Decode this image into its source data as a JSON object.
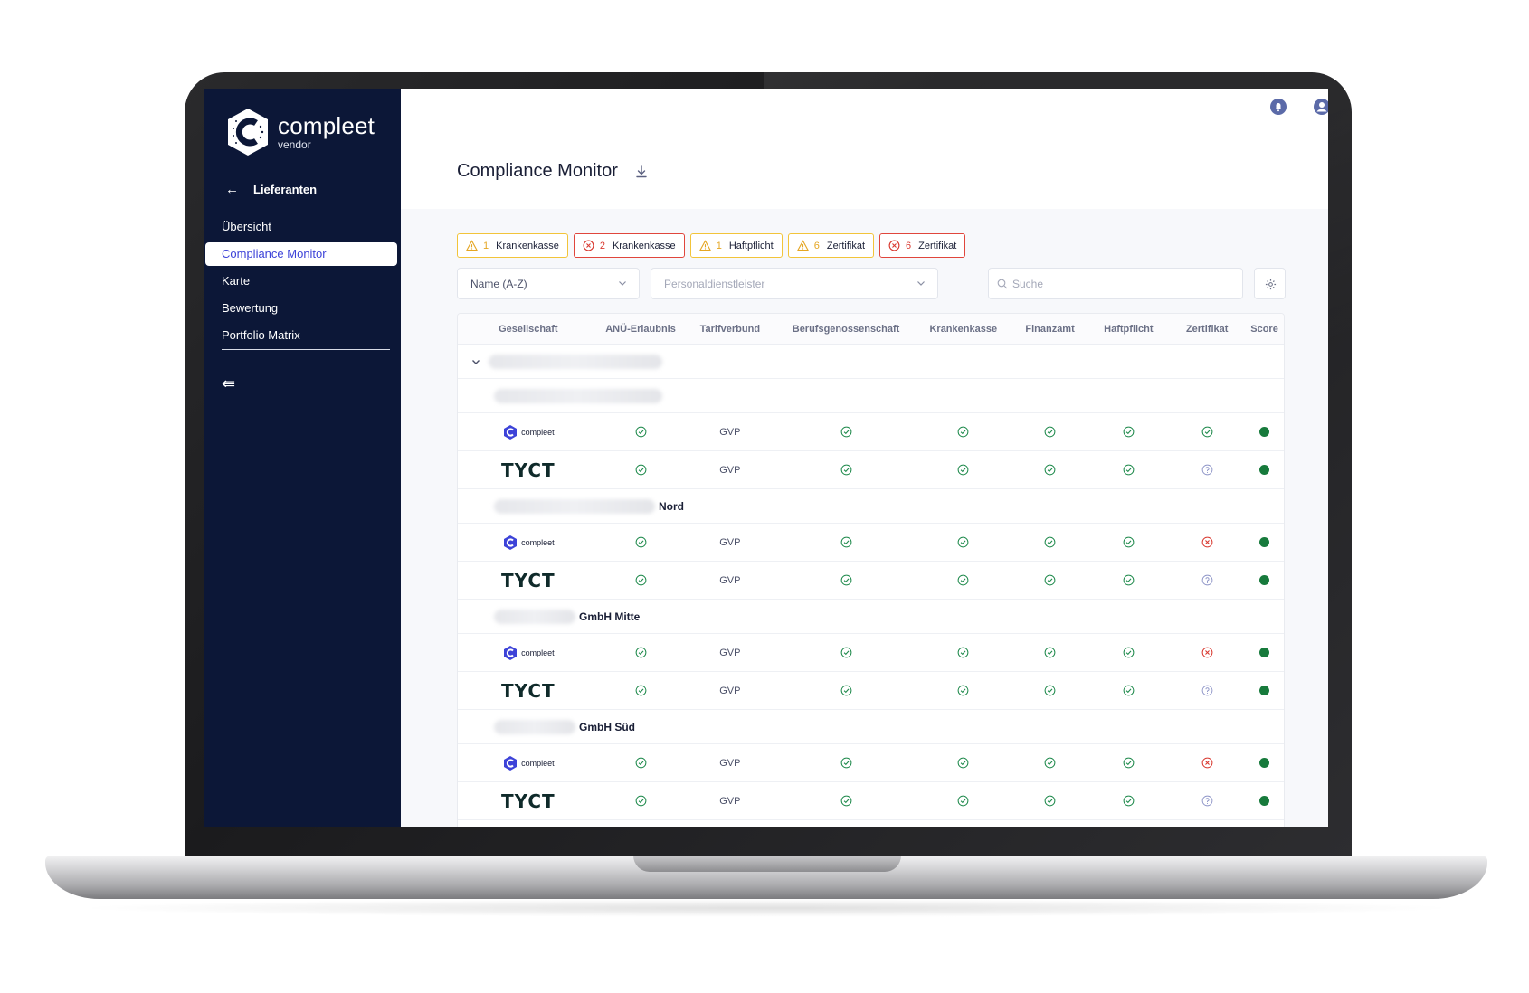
{
  "app": {
    "brand": "compleet",
    "brand_sub": "vendor"
  },
  "sidebar": {
    "back_label": "Lieferanten",
    "items": [
      {
        "label": "Übersicht",
        "active": false
      },
      {
        "label": "Compliance Monitor",
        "active": true
      },
      {
        "label": "Karte",
        "active": false
      },
      {
        "label": "Bewertung",
        "active": false
      },
      {
        "label": "Portfolio Matrix",
        "active": false
      }
    ]
  },
  "page": {
    "title": "Compliance Monitor"
  },
  "chips": [
    {
      "type": "warning",
      "count": "1",
      "label": "Krankenkasse"
    },
    {
      "type": "error",
      "count": "2",
      "label": "Krankenkasse"
    },
    {
      "type": "warning",
      "count": "1",
      "label": "Haftpflicht"
    },
    {
      "type": "warning",
      "count": "6",
      "label": "Zertifikat"
    },
    {
      "type": "error",
      "count": "6",
      "label": "Zertifikat"
    }
  ],
  "filters": {
    "sort_value": "Name (A-Z)",
    "provider_placeholder": "Personaldienstleister",
    "search_placeholder": "Suche"
  },
  "table": {
    "columns": [
      "Gesellschaft",
      "ANÜ-Erlaubnis",
      "Tarifverbund",
      "Berufsgenossenschaft",
      "Krankenkasse",
      "Finanzamt",
      "Haftpflicht",
      "Zertifikat",
      "Score"
    ],
    "groups": [
      {
        "name": "",
        "rows": [
          {
            "company": "compleet",
            "anue": "ok",
            "tarif": "GVP",
            "bg": "ok",
            "kk": "ok",
            "fa": "ok",
            "hp": "ok",
            "zert": "ok",
            "score": "green"
          },
          {
            "company": "TYCT",
            "anue": "ok",
            "tarif": "GVP",
            "bg": "ok",
            "kk": "ok",
            "fa": "ok",
            "hp": "ok",
            "zert": "unknown",
            "score": "green"
          }
        ]
      },
      {
        "name": "Nord",
        "rows": [
          {
            "company": "compleet",
            "anue": "ok",
            "tarif": "GVP",
            "bg": "ok",
            "kk": "ok",
            "fa": "ok",
            "hp": "ok",
            "zert": "error",
            "score": "green"
          },
          {
            "company": "TYCT",
            "anue": "ok",
            "tarif": "GVP",
            "bg": "ok",
            "kk": "ok",
            "fa": "ok",
            "hp": "ok",
            "zert": "unknown",
            "score": "green"
          }
        ]
      },
      {
        "name": "GmbH Mitte",
        "rows": [
          {
            "company": "compleet",
            "anue": "ok",
            "tarif": "GVP",
            "bg": "ok",
            "kk": "ok",
            "fa": "ok",
            "hp": "ok",
            "zert": "error",
            "score": "green"
          },
          {
            "company": "TYCT",
            "anue": "ok",
            "tarif": "GVP",
            "bg": "ok",
            "kk": "ok",
            "fa": "ok",
            "hp": "ok",
            "zert": "unknown",
            "score": "green"
          }
        ]
      },
      {
        "name": "GmbH Süd",
        "rows": [
          {
            "company": "compleet",
            "anue": "ok",
            "tarif": "GVP",
            "bg": "ok",
            "kk": "ok",
            "fa": "ok",
            "hp": "ok",
            "zert": "error",
            "score": "green"
          },
          {
            "company": "TYCT",
            "anue": "ok",
            "tarif": "GVP",
            "bg": "ok",
            "kk": "ok",
            "fa": "ok",
            "hp": "ok",
            "zert": "unknown",
            "score": "green"
          }
        ]
      }
    ]
  },
  "colors": {
    "sidebar_bg": "#0c1737",
    "accent": "#3d43d8",
    "ok": "#1f8a4c",
    "error": "#d93a31",
    "warning": "#f2c43a",
    "unknown": "#8f96c8",
    "score_green": "#177a3c"
  }
}
